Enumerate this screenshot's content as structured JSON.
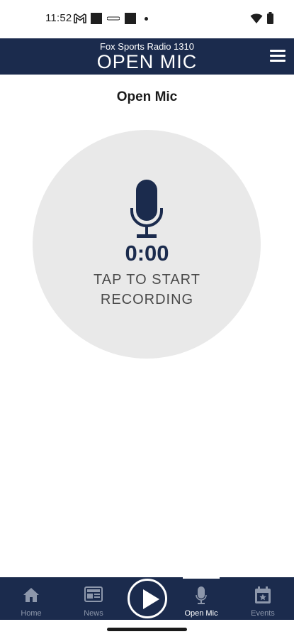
{
  "status_bar": {
    "time": "11:52",
    "icons": [
      "gmail-icon",
      "notification-square-icon",
      "notification-small-icon",
      "notification-square-icon",
      "dot-icon",
      "wifi-icon",
      "battery-icon"
    ]
  },
  "header": {
    "station": "Fox Sports Radio 1310",
    "title": "OPEN MIC",
    "menu_icon": "hamburger-menu-icon"
  },
  "main": {
    "heading": "Open Mic",
    "timer": "0:00",
    "prompt_line_1": "TAP TO START",
    "prompt_line_2": "RECORDING",
    "mic_icon": "microphone-icon"
  },
  "bottom_nav": {
    "items": [
      {
        "label": "Home",
        "icon": "home-icon",
        "active": false
      },
      {
        "label": "News",
        "icon": "newspaper-icon",
        "active": false
      },
      {
        "label": "Open Mic",
        "icon": "microphone-icon",
        "active": true
      },
      {
        "label": "Events",
        "icon": "calendar-star-icon",
        "active": false
      }
    ],
    "play_icon": "play-icon"
  },
  "colors": {
    "brand_navy": "#1b2b4d",
    "circle_gray": "#e9e9e9",
    "inactive_nav": "#8d97ab"
  }
}
